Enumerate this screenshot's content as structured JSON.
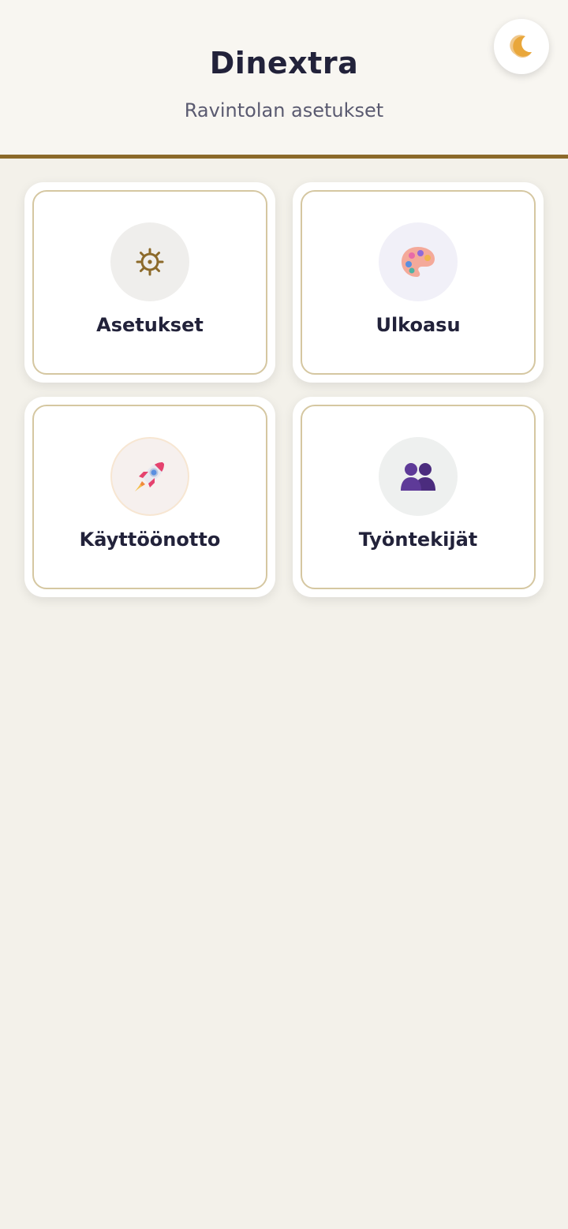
{
  "header": {
    "title": "Dinextra",
    "subtitle": "Ravintolan asetukset",
    "theme_toggle_icon": "crescent-moon-icon",
    "accent_color": "#8c6a2a"
  },
  "cards": [
    {
      "label": "Asetukset",
      "icon": "gear-icon",
      "icon_bg": "#efeeec"
    },
    {
      "label": "Ulkoasu",
      "icon": "palette-icon",
      "icon_bg": "#f1f0f8"
    },
    {
      "label": "Käyttöönotto",
      "icon": "rocket-icon",
      "icon_bg": "#f6f0ee"
    },
    {
      "label": "Työntekijät",
      "icon": "people-icon",
      "icon_bg": "#eef0ef"
    }
  ]
}
